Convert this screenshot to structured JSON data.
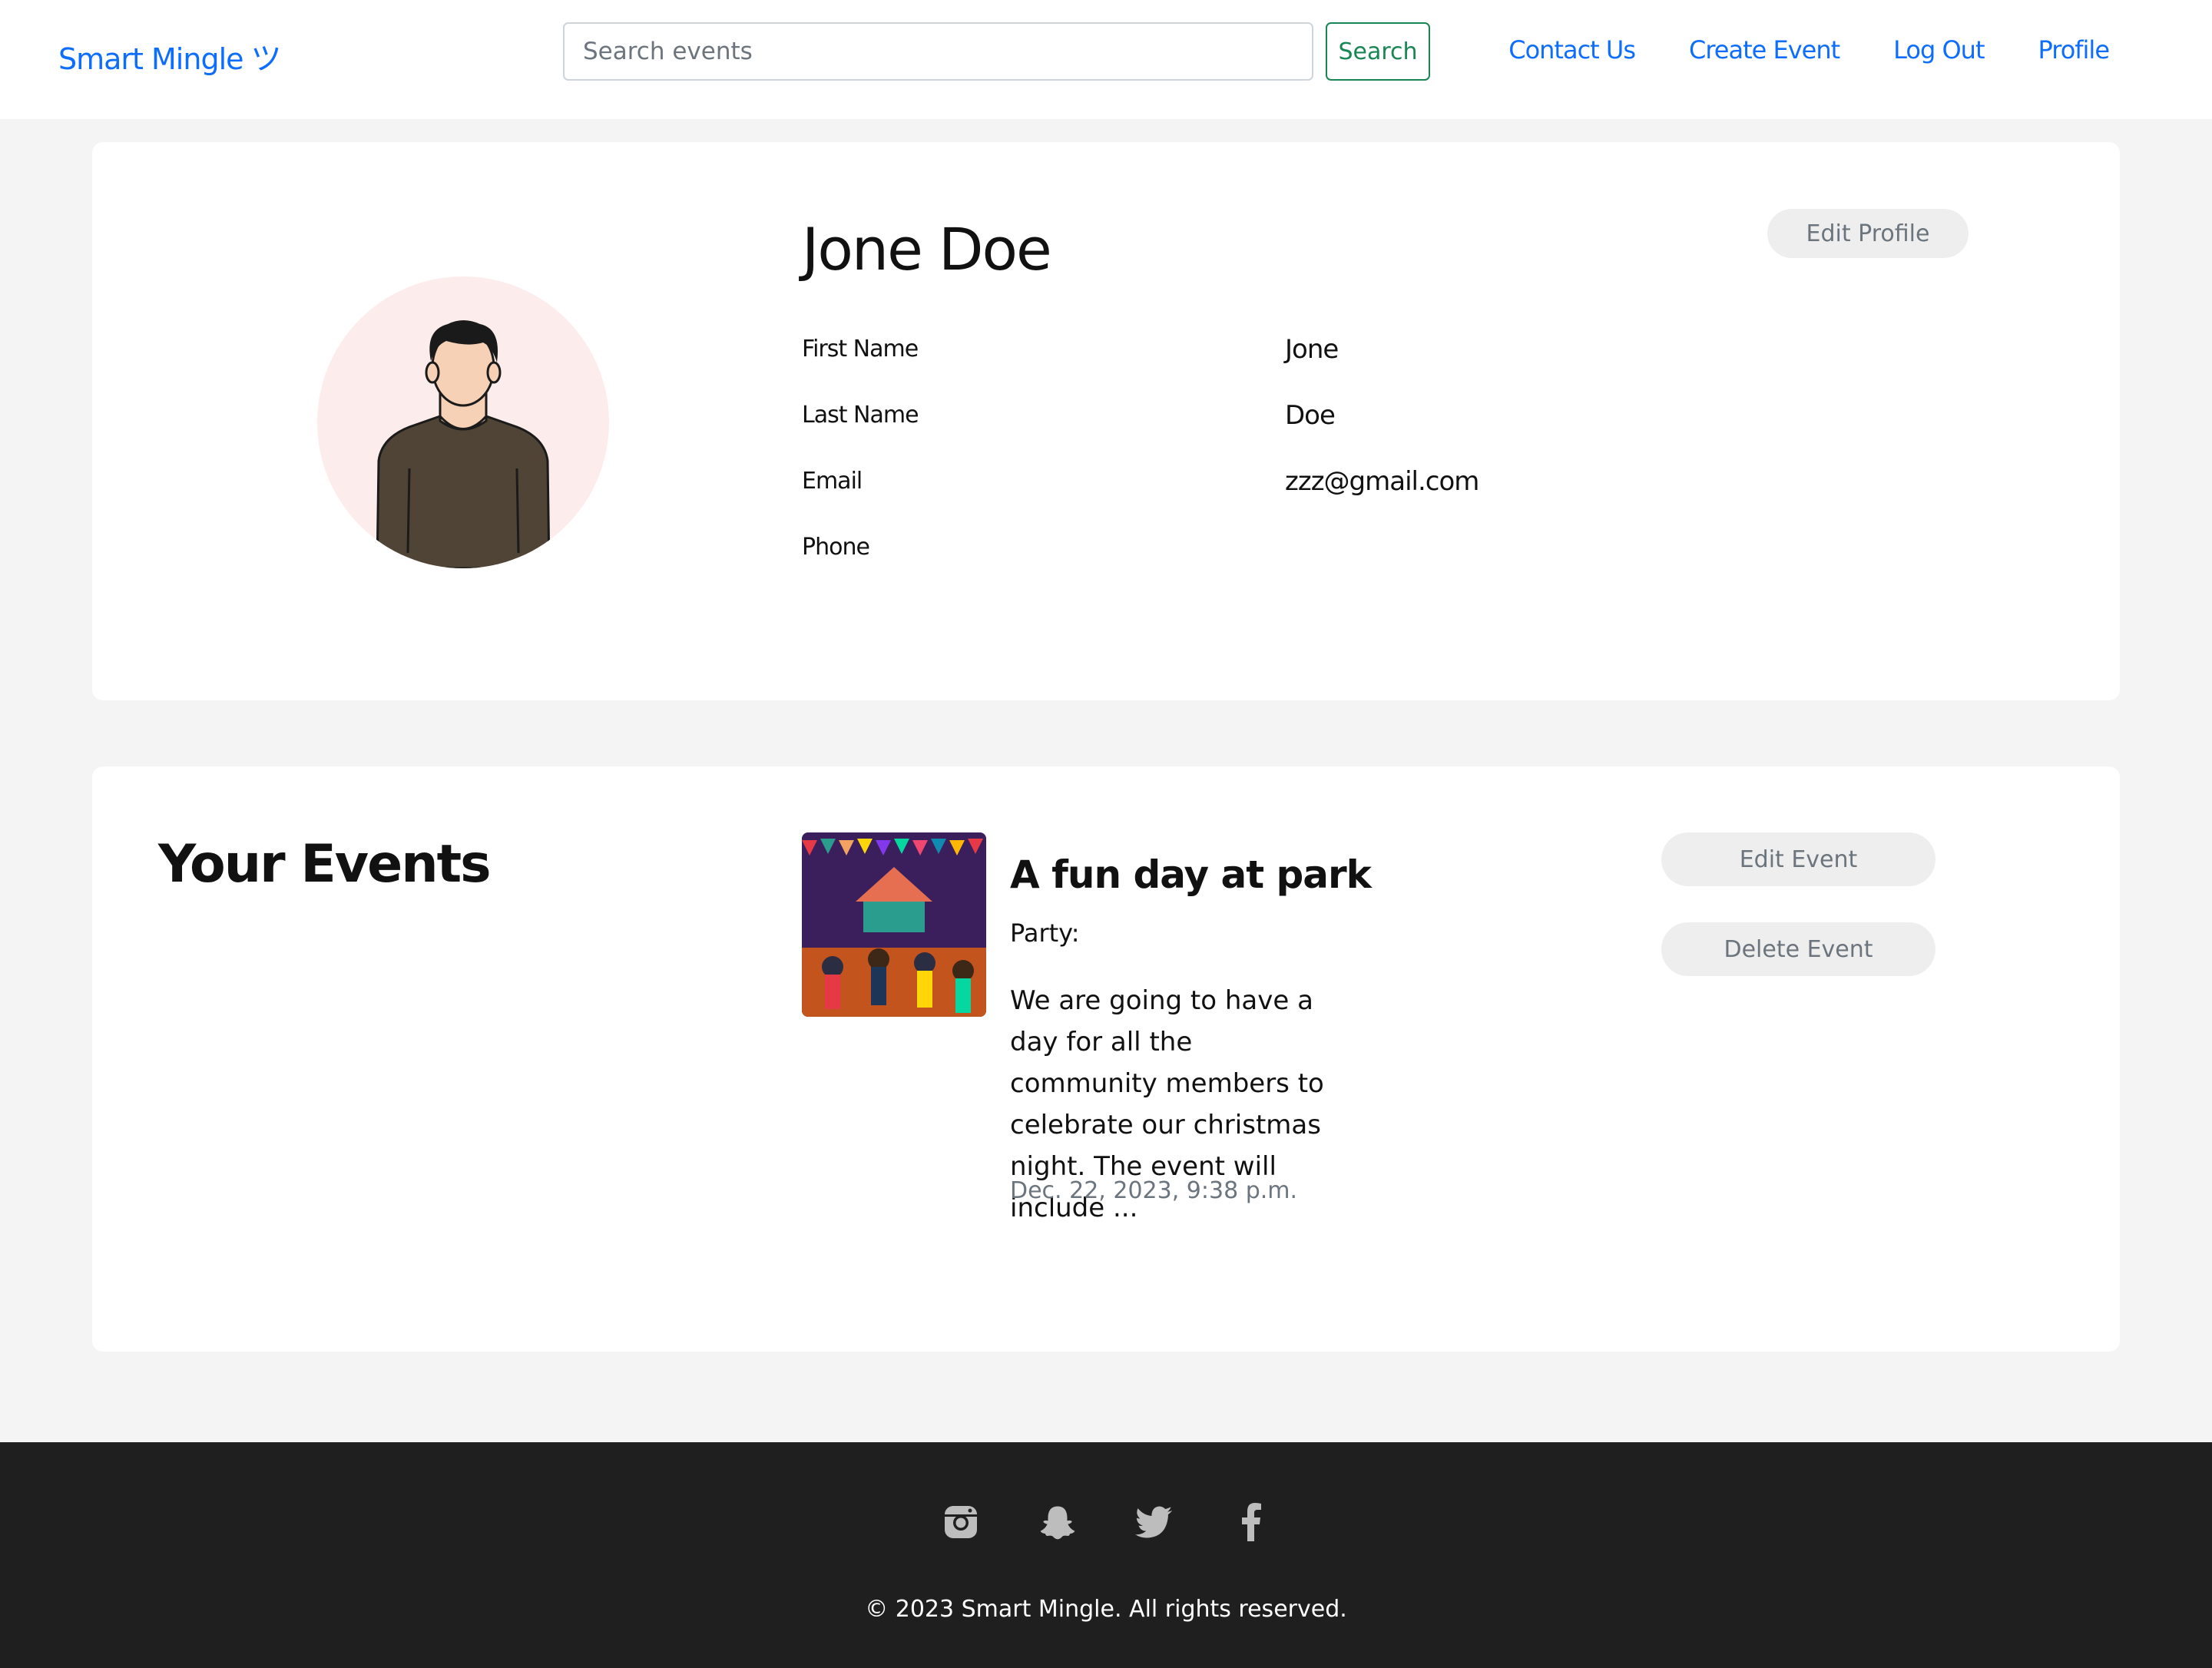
{
  "header": {
    "brand": "Smart Mingle",
    "brand_smile": "ツ",
    "search_placeholder": "Search events",
    "search_value": "",
    "search_button": "Search",
    "nav": [
      "Contact Us",
      "Create Event",
      "Log Out",
      "Profile"
    ]
  },
  "profile": {
    "name": "Jone Doe",
    "edit_button": "Edit Profile",
    "fields": [
      {
        "label": "First Name",
        "value": "Jone"
      },
      {
        "label": "Last Name",
        "value": "Doe"
      },
      {
        "label": "Email",
        "value": "zzz@gmail.com"
      },
      {
        "label": "Phone",
        "value": ""
      }
    ]
  },
  "events": {
    "title": "Your Events",
    "items": [
      {
        "title": "A fun day at park",
        "category": "Party:",
        "description": "We are going to have a day for all the community members to celebrate our christmas night. The event will include ...",
        "date": "Dec. 22, 2023, 9:38 p.m.",
        "edit_button": "Edit Event",
        "delete_button": "Delete Event"
      }
    ]
  },
  "footer": {
    "social_icons": [
      "instagram-icon",
      "snapchat-icon",
      "twitter-icon",
      "facebook-icon"
    ],
    "copyright": "© 2023 Smart Mingle. All rights reserved."
  },
  "colors": {
    "link": "#0d6efd",
    "search_button": "#198754",
    "footer_bg": "#1f1f1f",
    "page_bg": "#f4f4f4",
    "avatar_bg": "#fdecec"
  }
}
